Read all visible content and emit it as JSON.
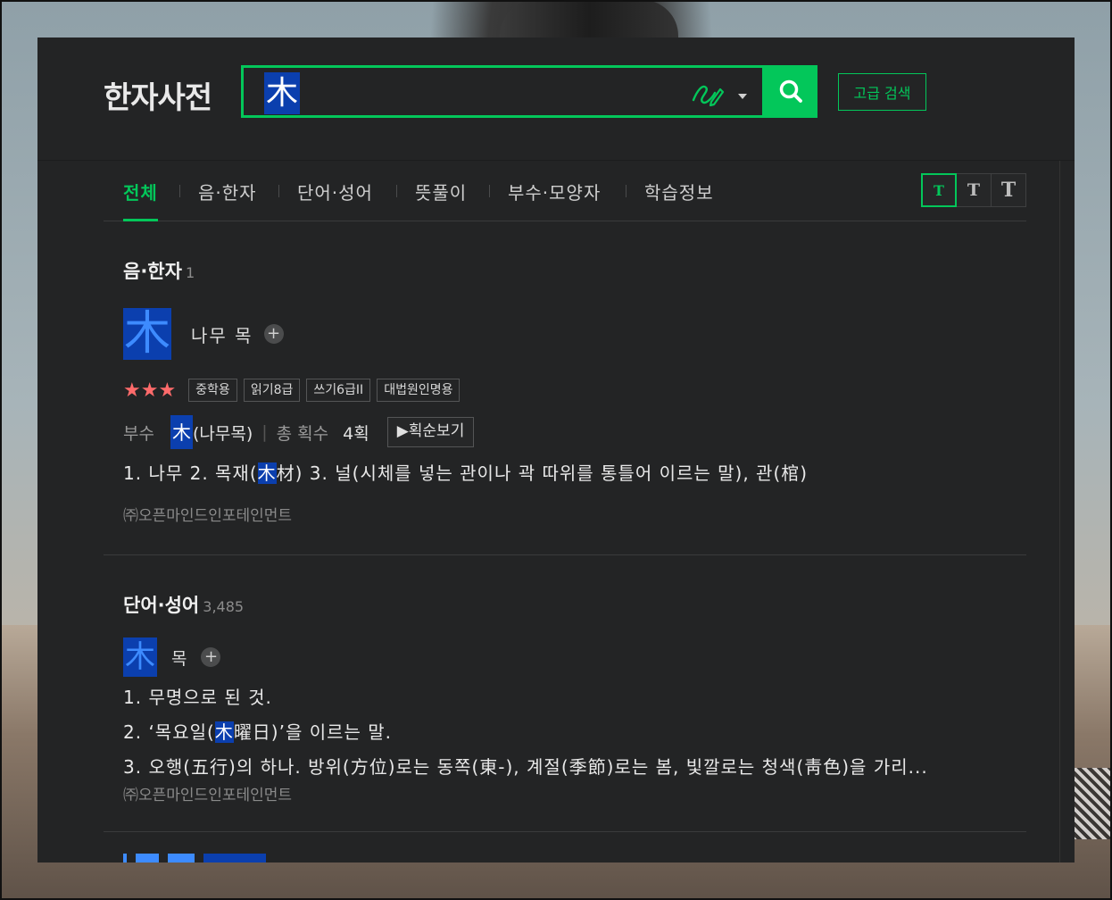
{
  "header": {
    "logo": "한자사전",
    "search_value": "木",
    "search_button_icon": "search-icon",
    "advanced_search": "고급 검색"
  },
  "tabs": [
    {
      "label": "전체",
      "active": true
    },
    {
      "label": "음·한자"
    },
    {
      "label": "단어·성어"
    },
    {
      "label": "뜻풀이"
    },
    {
      "label": "부수·모양자"
    },
    {
      "label": "학습정보"
    }
  ],
  "font_size_toggle": [
    "T",
    "T",
    "T"
  ],
  "eum_hanja": {
    "title": "음·한자",
    "count": "1",
    "entry": {
      "hanja": "木",
      "reading": "나무 목",
      "stars": "★★★",
      "tags": [
        "중학용",
        "읽기8급",
        "쓰기6급II",
        "대법원인명용"
      ],
      "radical_label": "부수",
      "radical_hanja": "木",
      "radical_name": "(나무목)",
      "strokes_label": "총 획수",
      "strokes_value": "4획",
      "stroke_order_button": "▶획순보기",
      "definition_parts": {
        "p1": "1. 나무  2. 목재(",
        "hl1": "木",
        "p2": "材)  3. 널(시체를 넣는 관이나 곽 따위를 통틀어 이르는 말), 관(棺)"
      },
      "source": "㈜오픈마인드인포테인먼트"
    }
  },
  "danuh_sungeo": {
    "title": "단어·성어",
    "count": "3,485",
    "entry": {
      "hanja": "木",
      "reading": "목",
      "def1": "1. 무명으로 된 것.",
      "def2_pre": "2. ‘목요일(",
      "def2_hl": "木",
      "def2_post": "曜日)’을 이르는 말.",
      "def3": "3. 오행(五行)의 하나. 방위(方位)로는 동쪽(東-), 계절(季節)로는 봄, 빛깔로는 청색(靑色)을 가리...",
      "source": "㈜오픈마인드인포테인먼트"
    }
  }
}
